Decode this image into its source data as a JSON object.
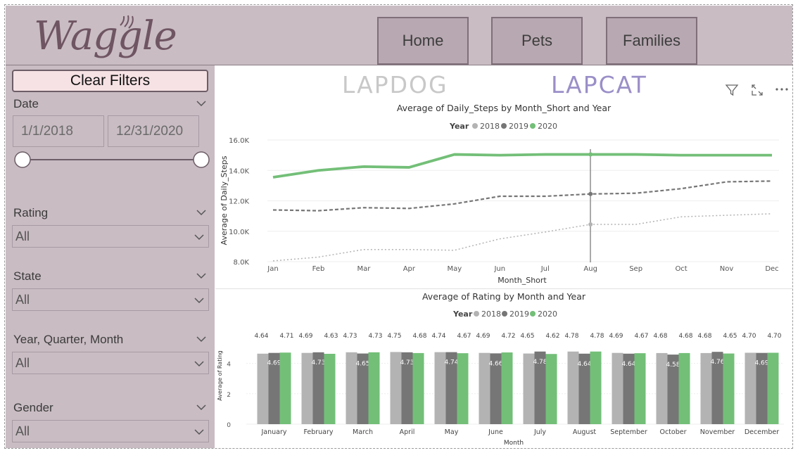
{
  "app": {
    "logo": "Waggle"
  },
  "nav": {
    "home": "Home",
    "pets": "Pets",
    "families": "Families"
  },
  "filters": {
    "clear": "Clear Filters",
    "date": {
      "label": "Date",
      "start": "1/1/2018",
      "end": "12/31/2020"
    },
    "rating": {
      "label": "Rating",
      "value": "All"
    },
    "state": {
      "label": "State",
      "value": "All"
    },
    "yqm": {
      "label": "Year, Quarter, Month",
      "value": "All"
    },
    "gender": {
      "label": "Gender",
      "value": "All"
    }
  },
  "brands": {
    "lapdog": "LAPDOG",
    "lapcat": "LAPCAT"
  },
  "colors": {
    "y2018": "#b3b3b3",
    "y2019": "#767676",
    "y2020": "#73bf78",
    "panel": "#c9bcc3"
  },
  "chart_data": [
    {
      "type": "line",
      "title": "Average of Daily_Steps by Month_Short and Year",
      "xlabel": "Month_Short",
      "ylabel": "Average of Daily_Steps",
      "legend_title": "Year",
      "legend_position": "top-center",
      "ylim": [
        8000,
        16000
      ],
      "yticks": [
        "8.0K",
        "10.0K",
        "12.0K",
        "14.0K",
        "16.0K"
      ],
      "categories": [
        "Jan",
        "Feb",
        "Mar",
        "Apr",
        "May",
        "Jun",
        "Jul",
        "Aug",
        "Sep",
        "Oct",
        "Nov",
        "Dec"
      ],
      "series": [
        {
          "name": "2018",
          "values": [
            8050,
            8300,
            8800,
            8800,
            8750,
            9500,
            9950,
            10450,
            10450,
            10950,
            11050,
            11150
          ]
        },
        {
          "name": "2019",
          "values": [
            11400,
            11350,
            11550,
            11500,
            11800,
            12300,
            12300,
            12450,
            12500,
            12800,
            13250,
            13300
          ]
        },
        {
          "name": "2020",
          "values": [
            13550,
            14000,
            14250,
            14200,
            15050,
            15000,
            15050,
            15050,
            15050,
            15000,
            15000,
            15000
          ]
        }
      ]
    },
    {
      "type": "bar",
      "title": "Average of Rating by Month and Year",
      "xlabel": "Month",
      "ylabel": "Average of Rating",
      "legend_title": "Year",
      "legend_position": "top-center",
      "ylim": [
        0,
        5
      ],
      "yticks": [
        "0",
        "2",
        "4"
      ],
      "categories": [
        "January",
        "February",
        "March",
        "April",
        "May",
        "June",
        "July",
        "August",
        "September",
        "October",
        "November",
        "December"
      ],
      "series": [
        {
          "name": "2018",
          "values": [
            4.64,
            4.69,
            4.73,
            4.75,
            4.74,
            4.69,
            4.65,
            4.78,
            4.69,
            4.68,
            4.68,
            4.7
          ]
        },
        {
          "name": "2019",
          "values": [
            4.69,
            4.73,
            4.65,
            4.73,
            4.74,
            4.66,
            4.78,
            4.64,
            4.64,
            4.58,
            4.76,
            4.69
          ]
        },
        {
          "name": "2020",
          "values": [
            4.71,
            4.63,
            4.73,
            4.68,
            4.67,
            4.72,
            4.62,
            4.78,
            4.67,
            4.68,
            4.65,
            4.7
          ]
        }
      ],
      "labels": [
        [
          "4.64",
          "4.69",
          "4.71"
        ],
        [
          "4.69",
          "4.73",
          "4.63"
        ],
        [
          "4.73",
          "4.65",
          "4.73"
        ],
        [
          "4.75",
          "4.73",
          "4.68"
        ],
        [
          "4.74",
          "4.74",
          "4.67"
        ],
        [
          "4.69",
          "4.66",
          "4.72"
        ],
        [
          "4.65",
          "4.78",
          "4.62"
        ],
        [
          "4.78",
          "4.64",
          "4.78"
        ],
        [
          "4.69",
          "4.64",
          "4.67"
        ],
        [
          "4.68",
          "4.58",
          "4.68"
        ],
        [
          "4.68",
          "4.76",
          "4.65"
        ],
        [
          "4.70",
          "4.69",
          "4.70"
        ]
      ]
    }
  ]
}
